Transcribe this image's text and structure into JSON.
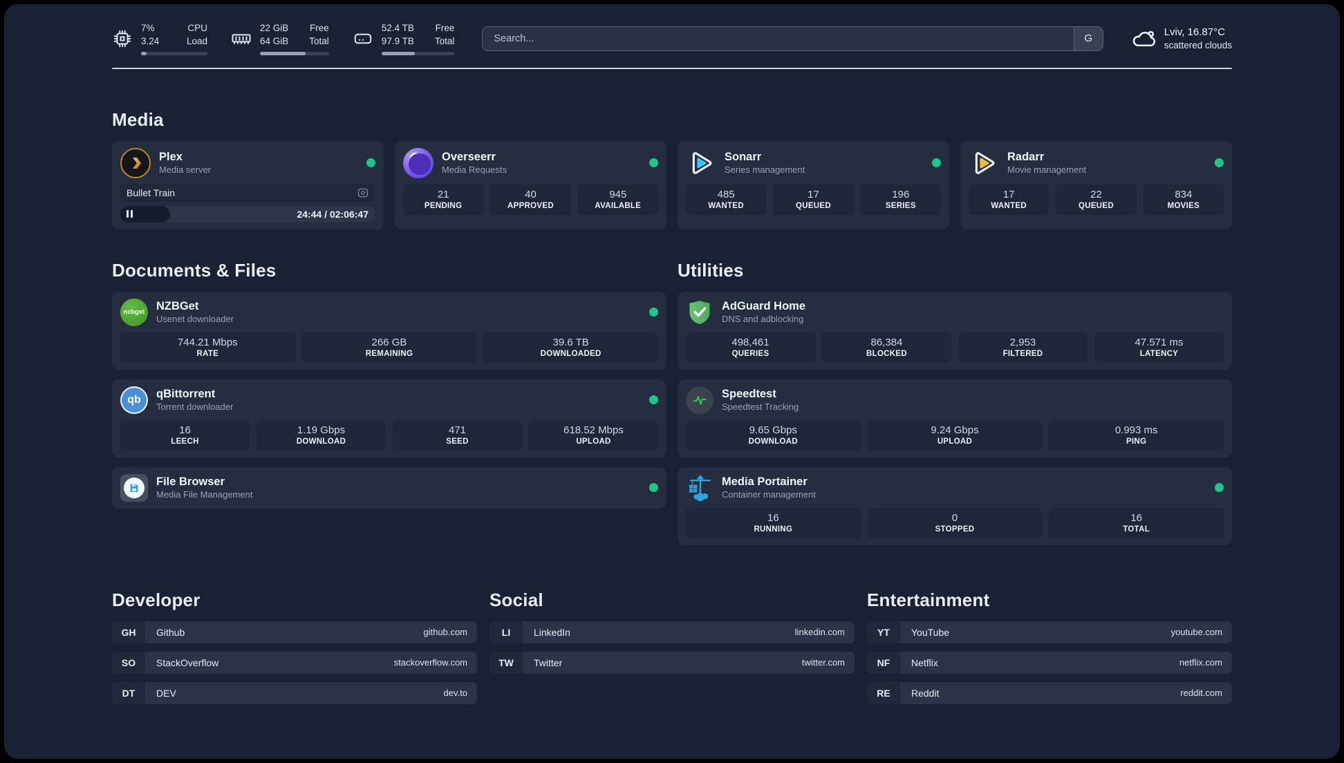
{
  "theme": {
    "background": "#1a2133",
    "card": "#252e40",
    "stat_box": "#1e2637",
    "status_online": "#1fc787",
    "accent_plex": "#e5a00d",
    "accent_sonarr": "#38c6f4",
    "accent_radarr": "#f5b92d",
    "accent_portainer": "#2aa7e0",
    "accent_adguard": "#5fb96a"
  },
  "header": {
    "stats": [
      {
        "icon": "cpu-icon",
        "value1": "7%",
        "value2": "3.24",
        "label1": "CPU",
        "label2": "Load",
        "progress": 8
      },
      {
        "icon": "memory-icon",
        "value1": "22 GiB",
        "value2": "64 GiB",
        "label1": "Free",
        "label2": "Total",
        "progress": 66
      },
      {
        "icon": "disk-icon",
        "value1": "52.4 TB",
        "value2": "97.9 TB",
        "label1": "Free",
        "label2": "Total",
        "progress": 46
      }
    ],
    "search": {
      "placeholder": "Search...",
      "button_label": "G"
    },
    "weather": {
      "location": "Lviv, 16.87°C",
      "condition": "scattered clouds"
    }
  },
  "media": {
    "title": "Media",
    "apps": [
      {
        "name": "Plex",
        "description": "Media server",
        "status": "online",
        "player": {
          "title": "Bullet Train",
          "time_display": "24:44 / 02:06:47",
          "progress_pct": 19.5,
          "state": "paused"
        }
      },
      {
        "name": "Overseerr",
        "description": "Media Requests",
        "status": "online",
        "stats": [
          {
            "value": "21",
            "label": "PENDING"
          },
          {
            "value": "40",
            "label": "APPROVED"
          },
          {
            "value": "945",
            "label": "AVAILABLE"
          }
        ]
      },
      {
        "name": "Sonarr",
        "description": "Series management",
        "status": "online",
        "stats": [
          {
            "value": "485",
            "label": "WANTED"
          },
          {
            "value": "17",
            "label": "QUEUED"
          },
          {
            "value": "196",
            "label": "SERIES"
          }
        ]
      },
      {
        "name": "Radarr",
        "description": "Movie management",
        "status": "online",
        "stats": [
          {
            "value": "17",
            "label": "WANTED"
          },
          {
            "value": "22",
            "label": "QUEUED"
          },
          {
            "value": "834",
            "label": "MOVIES"
          }
        ]
      }
    ]
  },
  "documents": {
    "title": "Documents & Files",
    "apps": [
      {
        "name": "NZBGet",
        "description": "Usenet downloader",
        "status": "online",
        "stats": [
          {
            "value": "744.21 Mbps",
            "label": "RATE"
          },
          {
            "value": "266 GB",
            "label": "REMAINING"
          },
          {
            "value": "39.6 TB",
            "label": "DOWNLOADED"
          }
        ]
      },
      {
        "name": "qBittorrent",
        "description": "Torrent downloader",
        "status": "online",
        "stats": [
          {
            "value": "16",
            "label": "LEECH"
          },
          {
            "value": "1.19 Gbps",
            "label": "DOWNLOAD"
          },
          {
            "value": "471",
            "label": "SEED"
          },
          {
            "value": "618.52 Mbps",
            "label": "UPLOAD"
          }
        ]
      },
      {
        "name": "File Browser",
        "description": "Media File Management",
        "status": "online",
        "stats": []
      }
    ]
  },
  "utilities": {
    "title": "Utilities",
    "apps": [
      {
        "name": "AdGuard Home",
        "description": "DNS and adblocking",
        "stats": [
          {
            "value": "498,461",
            "label": "QUERIES"
          },
          {
            "value": "86,384",
            "label": "BLOCKED"
          },
          {
            "value": "2,953",
            "label": "FILTERED"
          },
          {
            "value": "47.571 ms",
            "label": "LATENCY"
          }
        ]
      },
      {
        "name": "Speedtest",
        "description": "Speedtest Tracking",
        "stats": [
          {
            "value": "9.65 Gbps",
            "label": "DOWNLOAD"
          },
          {
            "value": "9.24 Gbps",
            "label": "UPLOAD"
          },
          {
            "value": "0.993 ms",
            "label": "PING"
          }
        ]
      },
      {
        "name": "Media Portainer",
        "description": "Container management",
        "status": "online",
        "stats": [
          {
            "value": "16",
            "label": "RUNNING"
          },
          {
            "value": "0",
            "label": "STOPPED"
          },
          {
            "value": "16",
            "label": "TOTAL"
          }
        ]
      }
    ]
  },
  "bookmarks": {
    "developer": {
      "title": "Developer",
      "links": [
        {
          "abbr": "GH",
          "name": "Github",
          "url": "github.com"
        },
        {
          "abbr": "SO",
          "name": "StackOverflow",
          "url": "stackoverflow.com"
        },
        {
          "abbr": "DT",
          "name": "DEV",
          "url": "dev.to"
        }
      ]
    },
    "social": {
      "title": "Social",
      "links": [
        {
          "abbr": "LI",
          "name": "LinkedIn",
          "url": "linkedin.com"
        },
        {
          "abbr": "TW",
          "name": "Twitter",
          "url": "twitter.com"
        }
      ]
    },
    "entertainment": {
      "title": "Entertainment",
      "links": [
        {
          "abbr": "YT",
          "name": "YouTube",
          "url": "youtube.com"
        },
        {
          "abbr": "NF",
          "name": "Netflix",
          "url": "netflix.com"
        },
        {
          "abbr": "RE",
          "name": "Reddit",
          "url": "reddit.com"
        }
      ]
    }
  }
}
